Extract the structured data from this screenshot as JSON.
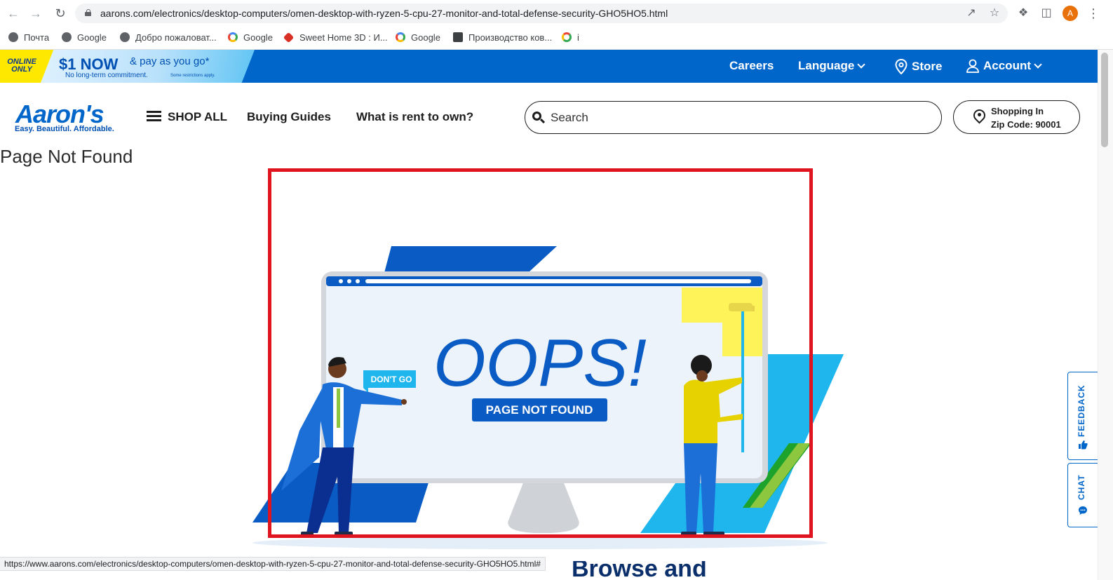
{
  "browser": {
    "url": "aarons.com/electronics/desktop-computers/omen-desktop-with-ryzen-5-cpu-27-monitor-and-total-defense-security-GHO5HO5.html",
    "profile_initial": "A",
    "bookmarks": [
      {
        "label": "Почта",
        "icon": "globe-icon"
      },
      {
        "label": "Google",
        "icon": "globe-icon"
      },
      {
        "label": "Добро пожаловат...",
        "icon": "globe-icon"
      },
      {
        "label": "Google",
        "icon": "google-icon"
      },
      {
        "label": "Sweet Home 3D : И...",
        "icon": "sweethome-icon"
      },
      {
        "label": "Google",
        "icon": "google-icon"
      },
      {
        "label": "Производство ков...",
        "icon": "carpet-icon"
      },
      {
        "label": "i",
        "icon": "ring-icon"
      }
    ],
    "status_url": "https://www.aarons.com/electronics/desktop-computers/omen-desktop-with-ryzen-5-cpu-27-monitor-and-total-defense-security-GHO5HO5.html#"
  },
  "promo": {
    "badge": "ONLINE ONLY",
    "headline": "$1 NOW",
    "headline_rest": "& pay as you go*",
    "subline": "No long-term commitment.",
    "fineprint": "Some restrictions apply."
  },
  "topnav": {
    "careers": "Careers",
    "language": "Language",
    "store": "Store",
    "account": "Account"
  },
  "header": {
    "logo": "Aaron's",
    "tagline": "Easy. Beautiful. Affordable.",
    "shop_all": "SHOP ALL",
    "buying_guides": "Buying Guides",
    "rent_to_own": "What is rent to own?",
    "search_placeholder": "Search",
    "zip_line1": "Shopping In",
    "zip_line2": "Zip Code: 90001"
  },
  "main": {
    "page_title": "Page Not Found",
    "oops": "OOPS!",
    "not_found_badge": "PAGE NOT FOUND",
    "speech": "DON'T GO",
    "bottom_heading": "Browse and"
  },
  "side": {
    "feedback": "FEEDBACK",
    "chat": "CHAT"
  },
  "colors": {
    "brand_blue": "#0066c9",
    "accent_cyan": "#1fb6ee",
    "promo_yellow": "#ffe800",
    "highlight_red": "#e0141e"
  }
}
